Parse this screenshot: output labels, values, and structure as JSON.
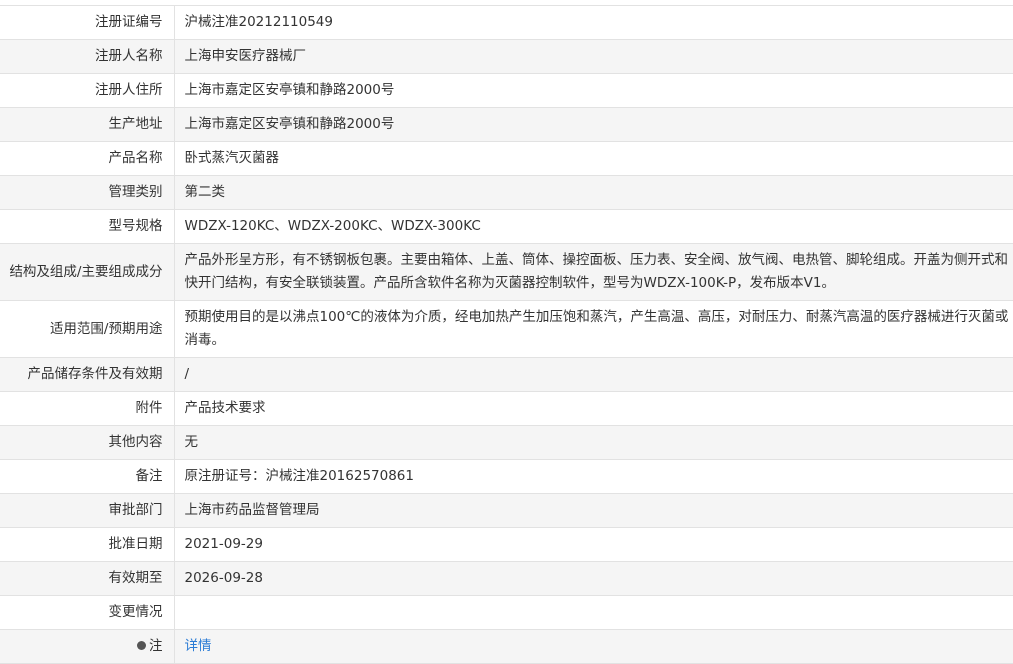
{
  "rows": [
    {
      "label": "注册证编号",
      "value": "沪械注准20212110549"
    },
    {
      "label": "注册人名称",
      "value": "上海申安医疗器械厂"
    },
    {
      "label": "注册人住所",
      "value": "上海市嘉定区安亭镇和静路2000号"
    },
    {
      "label": "生产地址",
      "value": "上海市嘉定区安亭镇和静路2000号"
    },
    {
      "label": "产品名称",
      "value": "卧式蒸汽灭菌器"
    },
    {
      "label": "管理类别",
      "value": "第二类"
    },
    {
      "label": "型号规格",
      "value": "WDZX-120KC、WDZX-200KC、WDZX-300KC"
    },
    {
      "label": "结构及组成/主要组成成分",
      "value": "产品外形呈方形，有不锈钢板包裹。主要由箱体、上盖、筒体、操控面板、压力表、安全阀、放气阀、电热管、脚轮组成。开盖为侧开式和快开门结构，有安全联锁装置。产品所含软件名称为灭菌器控制软件，型号为WDZX-100K-P，发布版本V1。"
    },
    {
      "label": "适用范围/预期用途",
      "value": "预期使用目的是以沸点100℃的液体为介质，经电加热产生加压饱和蒸汽，产生高温、高压，对耐压力、耐蒸汽高温的医疗器械进行灭菌或消毒。"
    },
    {
      "label": "产品储存条件及有效期",
      "value": "/"
    },
    {
      "label": "附件",
      "value": "产品技术要求"
    },
    {
      "label": "其他内容",
      "value": "无"
    },
    {
      "label": "备注",
      "value": "原注册证号：沪械注准20162570861"
    },
    {
      "label": "审批部门",
      "value": "上海市药品监督管理局"
    },
    {
      "label": "批准日期",
      "value": "2021-09-29"
    },
    {
      "label": "有效期至",
      "value": "2026-09-28"
    },
    {
      "label": "变更情况",
      "value": ""
    }
  ],
  "note": {
    "label": "注",
    "link_text": "详情",
    "icon": "dot-icon"
  }
}
